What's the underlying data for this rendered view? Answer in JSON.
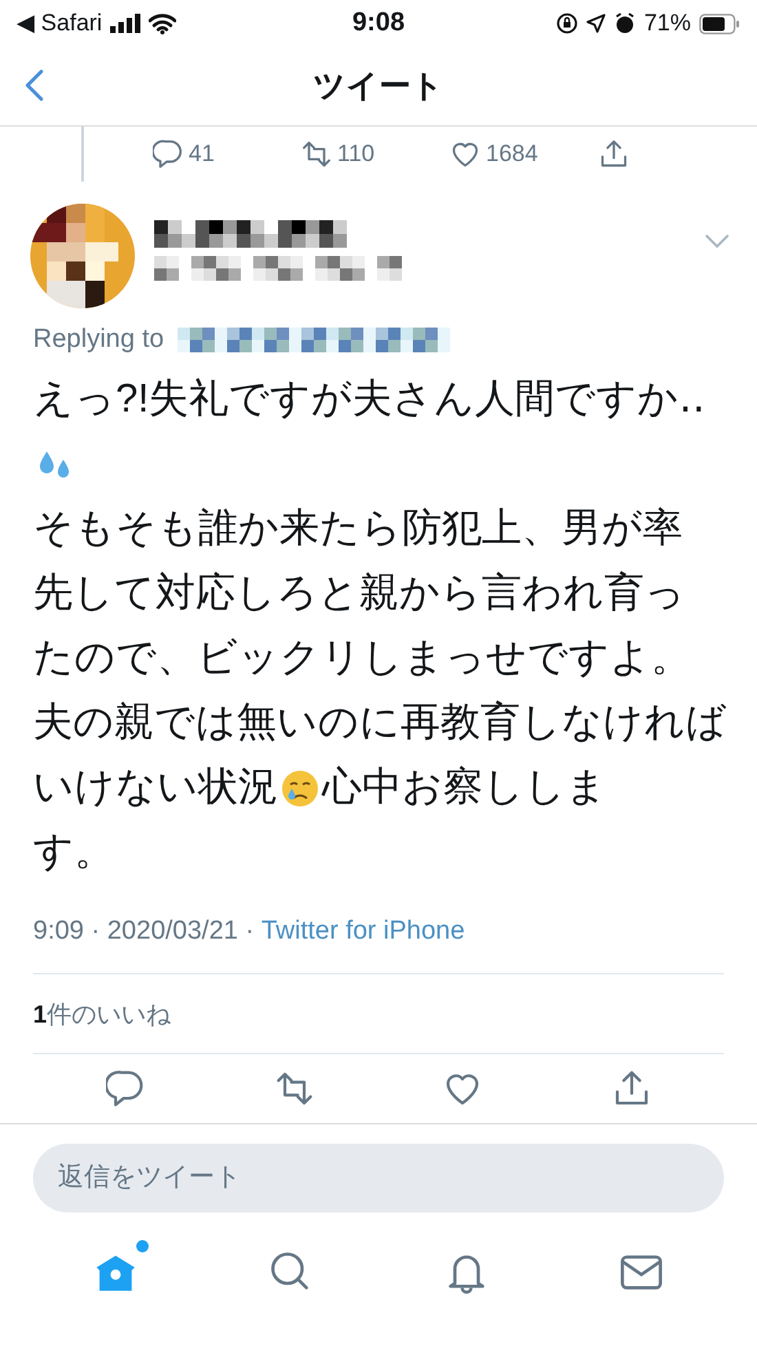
{
  "status_bar": {
    "back_app": "◀ Safari",
    "time": "9:08",
    "battery": "71%"
  },
  "header": {
    "title": "ツイート"
  },
  "parent_actions": [
    {
      "kind": "reply",
      "count": "41"
    },
    {
      "kind": "retweet",
      "count": "110"
    },
    {
      "kind": "like",
      "count": "1684"
    },
    {
      "kind": "share"
    }
  ],
  "tweet": {
    "replying_label": "Replying to",
    "body": [
      [
        {
          "kind": "text",
          "text": "えっ?!失礼ですが夫さん人間ですか‥"
        }
      ],
      [
        {
          "kind": "sweat_emoji"
        }
      ],
      [
        {
          "kind": "text",
          "text": "そもそも誰か来たら防犯上、男が率"
        }
      ],
      [
        {
          "kind": "text",
          "text": "先して対応しろと親から言われ育っ"
        }
      ],
      [
        {
          "kind": "text",
          "text": "たので、ビックリしまっせですよ。"
        }
      ],
      [
        {
          "kind": "text",
          "text": "夫の親では無いのに再教育しなければ"
        }
      ],
      [
        {
          "kind": "text",
          "text": "いけない状況"
        },
        {
          "kind": "crying_emoji"
        },
        {
          "kind": "text",
          "text": "心中お察ししま"
        }
      ],
      [
        {
          "kind": "text",
          "text": "す。"
        }
      ]
    ],
    "time": "9:09 · 2020/03/21 · ",
    "source": "Twitter for iPhone",
    "likes": {
      "count": "1",
      "label": "件のいいね"
    },
    "actions": [
      {
        "kind": "reply"
      },
      {
        "kind": "retweet"
      },
      {
        "kind": "like"
      },
      {
        "kind": "share"
      }
    ]
  },
  "reply_field": {
    "placeholder": "返信をツイート"
  },
  "tab_bar": [
    {
      "kind": "home",
      "selected": true,
      "badge": true
    },
    {
      "kind": "search",
      "selected": false
    },
    {
      "kind": "notifications",
      "selected": false
    },
    {
      "kind": "messages",
      "selected": false
    }
  ]
}
